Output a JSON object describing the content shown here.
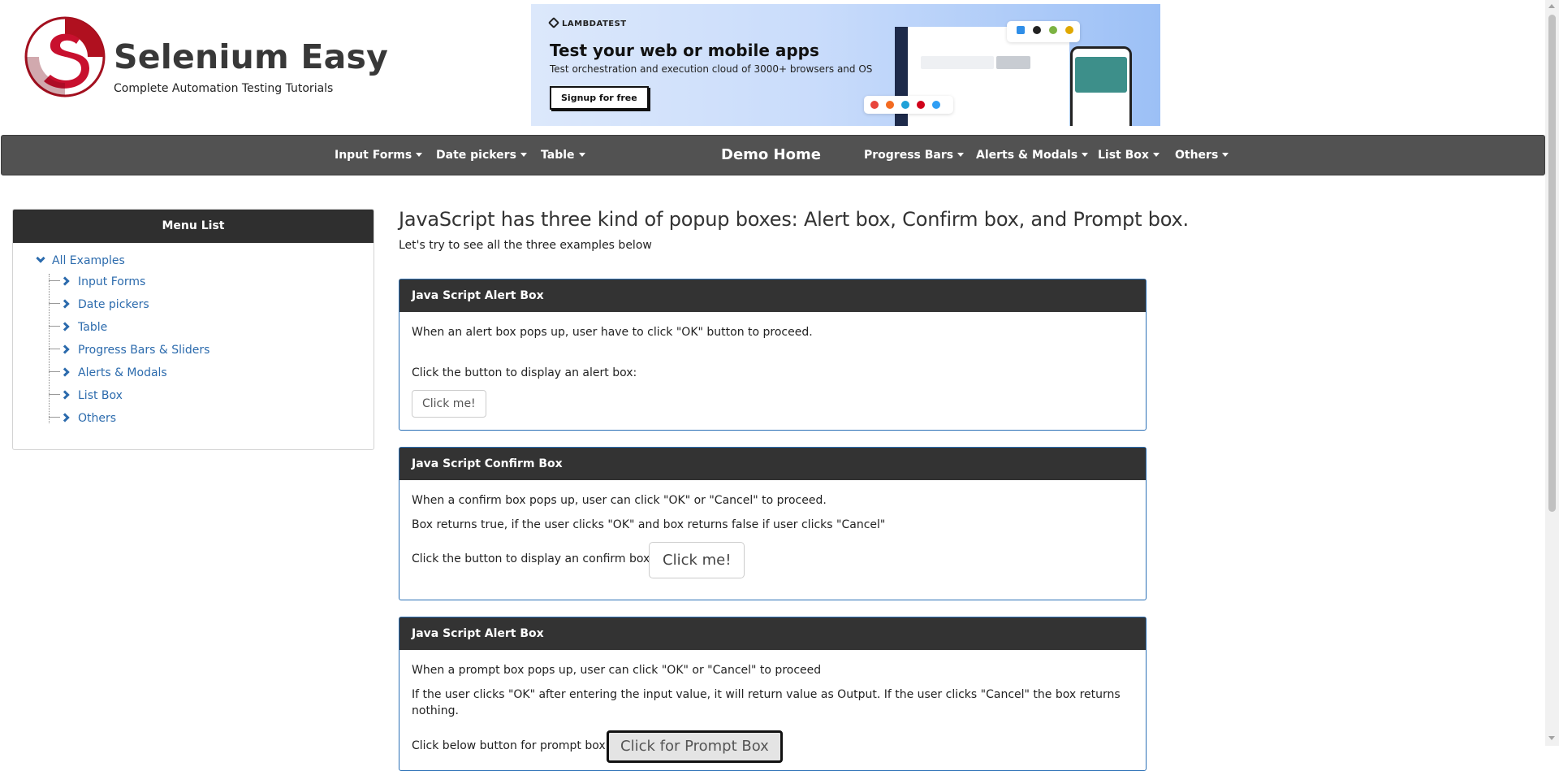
{
  "header": {
    "brand_title": "Selenium Easy",
    "brand_subtitle": "Complete Automation Testing Tutorials",
    "logo_color": "#c8102e"
  },
  "ad": {
    "brand": "LAMBDATEST",
    "title": "Test your web or mobile apps",
    "description": "Test orchestration and execution cloud of 3000+ browsers and OS",
    "cta": "Signup for free"
  },
  "navbar": {
    "brand": "Demo Home",
    "left_items": [
      "Input Forms",
      "Date pickers",
      "Table"
    ],
    "right_items": [
      "Progress Bars",
      "Alerts & Modals",
      "List Box",
      "Others"
    ]
  },
  "sidebar": {
    "title": "Menu List",
    "root": "All Examples",
    "items": [
      "Input Forms",
      "Date pickers",
      "Table",
      "Progress Bars & Sliders",
      "Alerts & Modals",
      "List Box",
      "Others"
    ]
  },
  "main": {
    "title": "JavaScript has three kind of popup boxes: Alert box, Confirm box, and Prompt box.",
    "subtitle": "Let's try to see all the three examples below"
  },
  "panels": [
    {
      "heading": "Java Script Alert Box",
      "line1": "When an alert box pops up, user have to click \"OK\" button to proceed.",
      "line2": "Click the button to display an alert box:",
      "button": "Click me!"
    },
    {
      "heading": "Java Script Confirm Box",
      "line1": "When a confirm box pops up, user can click \"OK\" or \"Cancel\" to proceed.",
      "line2": "Box returns true, if the user clicks \"OK\" and box returns false if user clicks \"Cancel\"",
      "line3": "Click the button to display an confirm box:",
      "button": "Click me!"
    },
    {
      "heading": "Java Script Alert Box",
      "line1": "When a prompt box pops up, user can click \"OK\" or \"Cancel\" to proceed",
      "line2": "If the user clicks \"OK\" after entering the input value, it will return value as Output. If the user clicks \"Cancel\" the box returns nothing.",
      "line3": "Click below button for prompt box",
      "button": "Click for Prompt Box"
    }
  ],
  "colors": {
    "navbar_bg": "#525252",
    "panel_head_bg": "#333333",
    "panel_border": "#2b70b6",
    "link": "#2c6bad"
  }
}
